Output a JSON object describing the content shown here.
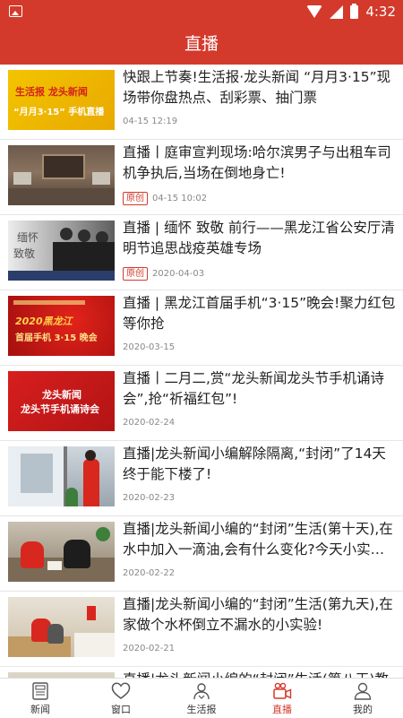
{
  "status_bar": {
    "time": "4:32"
  },
  "header": {
    "title": "直播"
  },
  "accent_color": "#d33a2c",
  "items": [
    {
      "title": "快跟上节奏!生活报·龙头新闻 “月月3·15”现场带你盘热点、刮彩票、抽门票",
      "date": "04-15 12:19",
      "tag": "",
      "thumb": {
        "line1": "生活报  龙头新闻",
        "line2": "“月月3·15” 手机直播"
      }
    },
    {
      "title": "直播丨庭审宣判现场:哈尔滨男子与出租车司机争执后,当场在倒地身亡!",
      "date": "04-15 10:02",
      "tag": "原创",
      "thumb": {
        "line1": "",
        "line2": ""
      }
    },
    {
      "title": "直播 | 缅怀 致敬 前行——黑龙江省公安厅清明节追思战疫英雄专场",
      "date": "2020-04-03",
      "tag": "原创",
      "thumb": {
        "line1": "缅怀",
        "line2": "致敬"
      }
    },
    {
      "title": "直播 | 黑龙江首届手机“3·15”晚会!聚力红包等你抢",
      "date": "2020-03-15",
      "tag": "",
      "thumb": {
        "line1": "2020黑龙江",
        "line2": "首届手机 3·15 晚会"
      }
    },
    {
      "title": "直播丨二月二,赏“龙头新闻龙头节手机诵诗会”,抢“祈福红包”!",
      "date": "2020-02-24",
      "tag": "",
      "thumb": {
        "line1": "龙头新闻",
        "line2": "龙头节手机诵诗会"
      }
    },
    {
      "title": "直播|龙头新闻小编解除隔离,“封闭”了14天终于能下楼了!",
      "date": "2020-02-23",
      "tag": "",
      "thumb": {
        "line1": "",
        "line2": ""
      }
    },
    {
      "title": "直播|龙头新闻小编的“封闭”生活(第十天),在水中加入一滴油,会有什么变化?今天小实…",
      "date": "2020-02-22",
      "tag": "",
      "thumb": {
        "line1": "",
        "line2": ""
      }
    },
    {
      "title": "直播|龙头新闻小编的“封闭”生活(第九天),在家做个水杯倒立不漏水的小实验!",
      "date": "2020-02-21",
      "tag": "",
      "thumb": {
        "line1": "",
        "line2": ""
      }
    },
    {
      "title": "直播|龙头新闻小编的“封闭”生活(第八天)教",
      "date": "",
      "tag": "",
      "thumb": {
        "line1": "",
        "line2": ""
      }
    }
  ],
  "tabs": [
    {
      "label": "新闻",
      "icon": "newspaper-icon",
      "active": false
    },
    {
      "label": "窗口",
      "icon": "heart-icon",
      "active": false
    },
    {
      "label": "生活报",
      "icon": "people-icon",
      "active": false
    },
    {
      "label": "直播",
      "icon": "video-camera-icon",
      "active": true
    },
    {
      "label": "我的",
      "icon": "user-icon",
      "active": false
    }
  ]
}
